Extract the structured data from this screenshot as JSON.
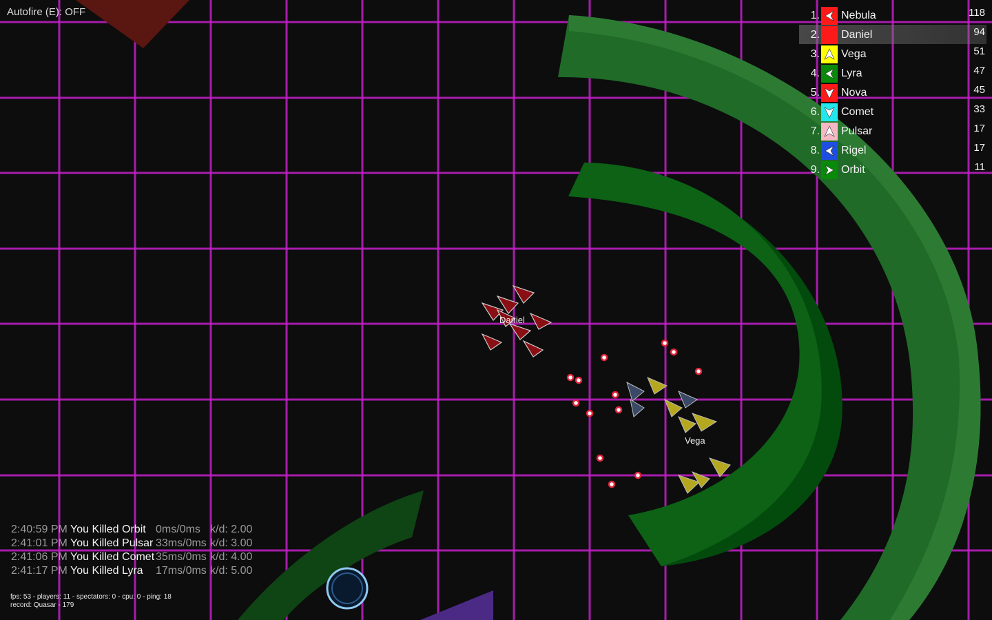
{
  "hud": {
    "autofire_label": "Autofire (E): OFF"
  },
  "leaderboard": [
    {
      "rank": "1.",
      "name": "Nebula",
      "score": "118",
      "color": "#ff1a1a",
      "icon": "arrow-left-icon",
      "me": false
    },
    {
      "rank": "2.",
      "name": "Daniel",
      "score": "94",
      "color": "#ff1a1a",
      "icon": "none",
      "me": true
    },
    {
      "rank": "3.",
      "name": "Vega",
      "score": "51",
      "color": "#ffff00",
      "icon": "arrow-up-icon",
      "me": false
    },
    {
      "rank": "4.",
      "name": "Lyra",
      "score": "47",
      "color": "#0a8a0a",
      "icon": "arrow-left-icon",
      "me": false
    },
    {
      "rank": "5.",
      "name": "Nova",
      "score": "45",
      "color": "#ff1a1a",
      "icon": "arrow-down-icon",
      "me": false
    },
    {
      "rank": "6.",
      "name": "Comet",
      "score": "33",
      "color": "#22e8ee",
      "icon": "arrow-down-icon",
      "me": false
    },
    {
      "rank": "7.",
      "name": "Pulsar",
      "score": "17",
      "color": "#f5b8c4",
      "icon": "arrow-up-icon",
      "me": false
    },
    {
      "rank": "8.",
      "name": "Rigel",
      "score": "17",
      "color": "#1f4fe0",
      "icon": "arrow-left-icon",
      "me": false
    },
    {
      "rank": "9.",
      "name": "Orbit",
      "score": "11",
      "color": "#0a8a0a",
      "icon": "arrow-right-icon",
      "me": false
    }
  ],
  "killfeed": [
    {
      "time": "2:40:59 PM",
      "message": "You Killed Orbit",
      "ping": "0ms/0ms",
      "kd": "k/d: 2.00"
    },
    {
      "time": "2:41:01 PM",
      "message": "You Killed Pulsar",
      "ping": "33ms/0ms",
      "kd": "k/d: 3.00"
    },
    {
      "time": "2:41:06 PM",
      "message": "You Killed Comet",
      "ping": "35ms/0ms",
      "kd": "k/d: 4.00"
    },
    {
      "time": "2:41:17 PM",
      "message": "You Killed Lyra",
      "ping": "17ms/0ms",
      "kd": "k/d: 5.00"
    }
  ],
  "stats": {
    "line1": "fps: 53 - players: 11 - spectators: 0 - cpu: 0 - ping: 18",
    "line2": "record: Quasar - 179"
  },
  "world": {
    "grid_color": "#c21fc8",
    "background": "#0d0d0d",
    "ships": [
      {
        "label": "Daniel",
        "team_color": "#8a0f14"
      },
      {
        "label": "Vega",
        "team_color": "#b5a81f"
      }
    ]
  }
}
